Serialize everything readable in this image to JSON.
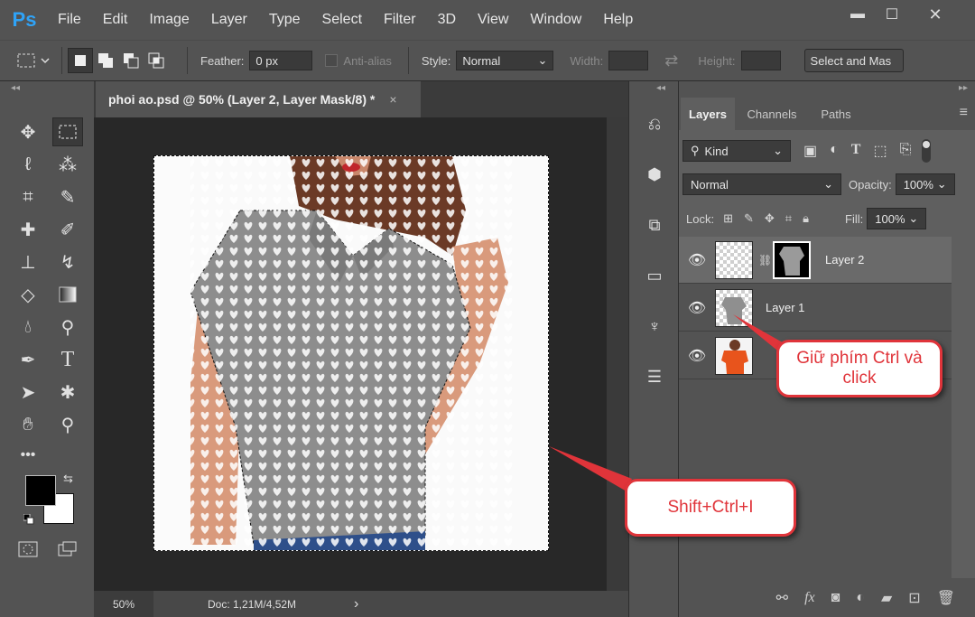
{
  "app": {
    "logo": "Ps"
  },
  "menu": [
    "File",
    "Edit",
    "Image",
    "Layer",
    "Type",
    "Select",
    "Filter",
    "3D",
    "View",
    "Window",
    "Help"
  ],
  "window_controls": {
    "minimize": "▬",
    "maximize": "☐",
    "close": "✕"
  },
  "options": {
    "feather_label": "Feather:",
    "feather_value": "0 px",
    "antialias_label": "Anti-alias",
    "style_label": "Style:",
    "style_value": "Normal",
    "width_label": "Width:",
    "height_label": "Height:",
    "select_mask_label": "Select and Mas"
  },
  "document": {
    "tab_title": "phoi ao.psd @ 50% (Layer 2, Layer Mask/8) *",
    "tab_close": "×",
    "zoom": "50%",
    "doc_info": "Doc: 1,21M/4,52M",
    "status_arrow": "›"
  },
  "panel": {
    "tabs": [
      "Layers",
      "Channels",
      "Paths"
    ],
    "filter_kind": "Kind",
    "blend_mode": "Normal",
    "opacity_label": "Opacity:",
    "opacity_value": "100%",
    "lock_label": "Lock:",
    "fill_label": "Fill:",
    "fill_value": "100%",
    "layers": [
      {
        "name": "Layer 2"
      },
      {
        "name": "Layer 1"
      },
      {
        "name": ""
      }
    ],
    "bottom_icons": [
      "link-icon",
      "fx-icon",
      "mask-icon",
      "adjustment-icon",
      "folder-icon",
      "new-layer-icon",
      "trash-icon"
    ],
    "fx_label": "fx"
  },
  "callouts": {
    "ctrl_click": "Giữ phím Ctrl và click",
    "shortcut": "Shift+Ctrl+I"
  },
  "colors": {
    "accent": "#2fa3f7",
    "callout": "#e0343a",
    "selected_layer": "#6a6a6a"
  }
}
